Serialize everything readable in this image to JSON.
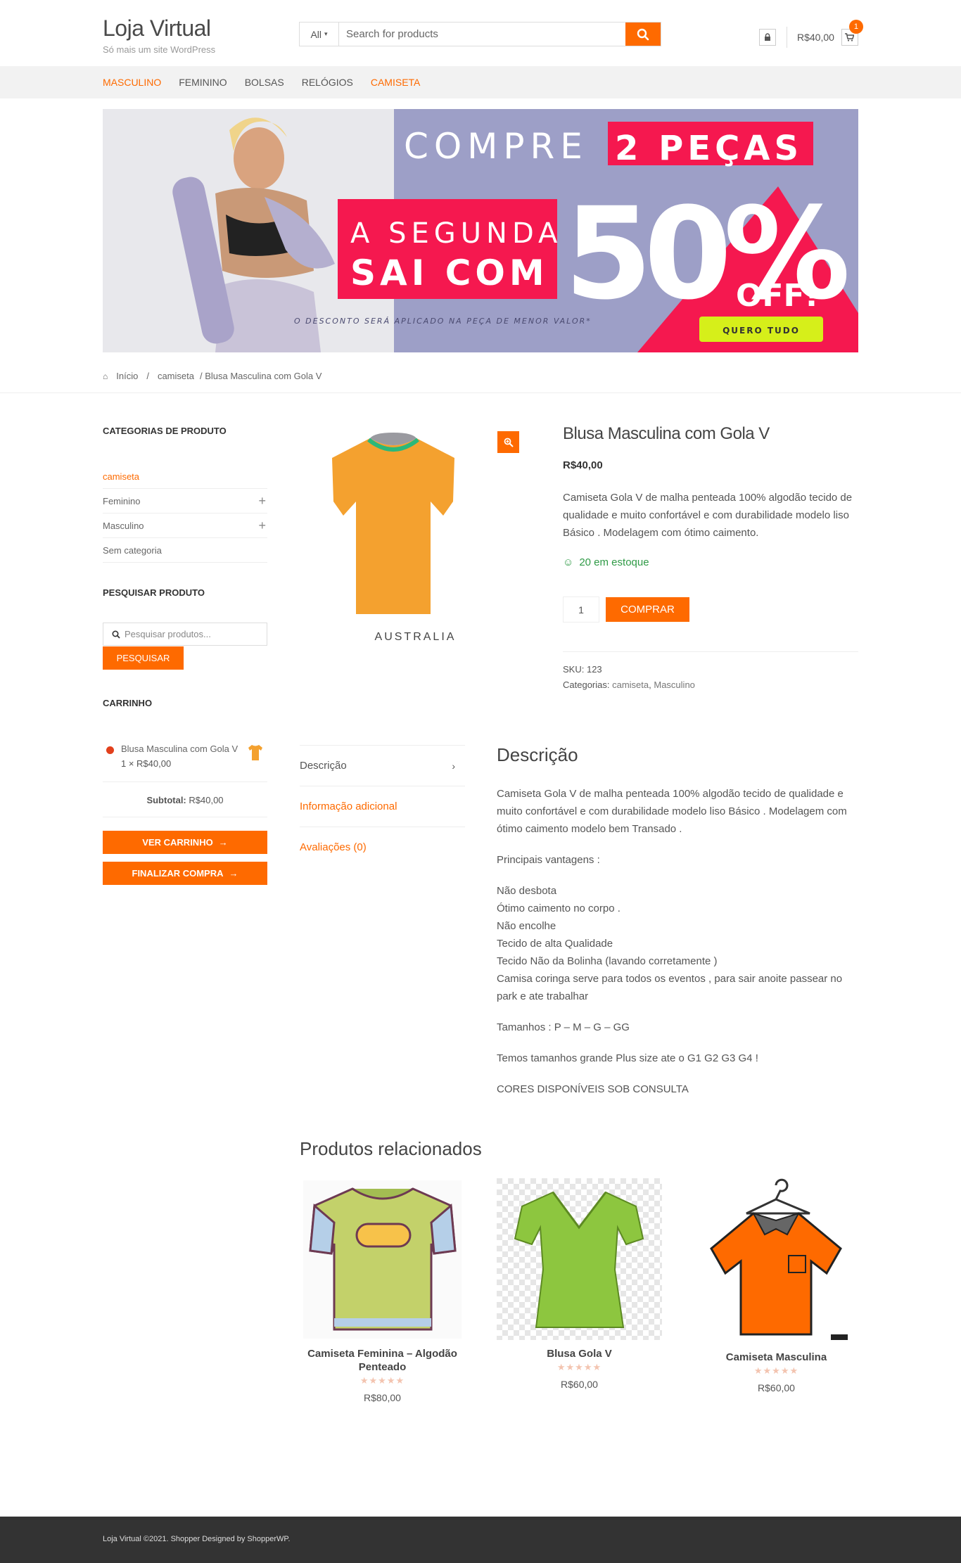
{
  "site": {
    "title": "Loja Virtual",
    "tagline": "Só mais um site WordPress"
  },
  "header": {
    "search_category": "All",
    "search_placeholder": "Search for products",
    "cart_total": "R$40,00",
    "cart_count": "1"
  },
  "nav": {
    "items": [
      {
        "label": "MASCULINO",
        "active": true
      },
      {
        "label": "FEMININO",
        "active": false
      },
      {
        "label": "BOLSAS",
        "active": false
      },
      {
        "label": "RELÓGIOS",
        "active": false
      },
      {
        "label": "CAMISETA",
        "active": true
      }
    ]
  },
  "banner": {
    "line1a": "COMPRE",
    "line1b": "2 PEÇAS",
    "line2": "A SEGUNDA",
    "line3": "SAI COM",
    "big": "50%",
    "off": "OFF!",
    "footnote": "O DESCONTO SERÁ APLICADO NA PEÇA DE MENOR VALOR*",
    "cta": "QUERO TUDO"
  },
  "breadcrumb": {
    "home": "Início",
    "sep": "/",
    "cat": "camiseta",
    "current": "/ Blusa Masculina com Gola V"
  },
  "sidebar": {
    "categories_title": "CATEGORIAS DE PRODUTO",
    "categories": [
      {
        "label": "camiseta",
        "expandable": false
      },
      {
        "label": "Feminino",
        "expandable": true
      },
      {
        "label": "Masculino",
        "expandable": true
      },
      {
        "label": "Sem categoria",
        "expandable": false
      }
    ],
    "search_title": "PESQUISAR PRODUTO",
    "search_placeholder": "Pesquisar produtos...",
    "search_button": "PESQUISAR",
    "cart_title": "CARRINHO",
    "cart_item_name": "Blusa Masculina com Gola V",
    "cart_item_qty": "1 × R$40,00",
    "subtotal_label": "Subtotal:",
    "subtotal_value": "R$40,00",
    "view_cart": "VER CARRINHO",
    "checkout": "FINALIZAR COMPRA"
  },
  "product": {
    "image_caption": "AUSTRALIA",
    "title": "Blusa Masculina com Gola V",
    "price": "R$40,00",
    "short_description": "Camiseta Gola V de malha penteada 100% algodão tecido de qualidade e muito confortável e com durabilidade modelo liso Básico . Modelagem com ótimo caimento.",
    "stock": "20 em estoque",
    "qty": "1",
    "buy_button": "COMPRAR",
    "sku_label": "SKU:",
    "sku": "123",
    "categories_label": "Categorias:",
    "category_1": "camiseta",
    "category_2": "Masculino"
  },
  "tabs": [
    {
      "label": "Descrição",
      "active": true
    },
    {
      "label": "Informação adicional",
      "active": false
    },
    {
      "label": "Avaliações (0)",
      "active": false
    }
  ],
  "description": {
    "heading": "Descrição",
    "p1": "Camiseta Gola V de malha penteada 100% algodão tecido de qualidade e muito confortável e com durabilidade modelo liso Básico . Modelagem com ótimo caimento modelo bem Transado .",
    "p2": "Principais vantagens :",
    "list": [
      "Não desbota",
      "Ótimo caimento no corpo .",
      "Não encolhe",
      "Tecido de alta Qualidade",
      "Tecido Não da Bolinha (lavando corretamente )",
      "Camisa coringa serve para todos os eventos , para sair anoite passear no park e ate trabalhar"
    ],
    "p3": "Tamanhos : P – M – G – GG",
    "p4": "Temos tamanhos grande Plus size ate o G1 G2 G3 G4 !",
    "p5": "CORES DISPONÍVEIS SOB CONSULTA"
  },
  "related": {
    "title": "Produtos relacionados",
    "items": [
      {
        "name": "Camiseta Feminina – Algodão Penteado",
        "price": "R$80,00",
        "stars": "★★★★★"
      },
      {
        "name": "Blusa Gola V",
        "price": "R$60,00",
        "stars": "★★★★★"
      },
      {
        "name": "Camiseta Masculina",
        "price": "R$60,00",
        "stars": "★★★★★"
      }
    ]
  },
  "footer": {
    "text": "Loja Virtual ©2021. Shopper Designed by ShopperWP."
  },
  "colors": {
    "accent": "#fe6a00",
    "stock": "#2f9a46",
    "footer": "#333333"
  }
}
